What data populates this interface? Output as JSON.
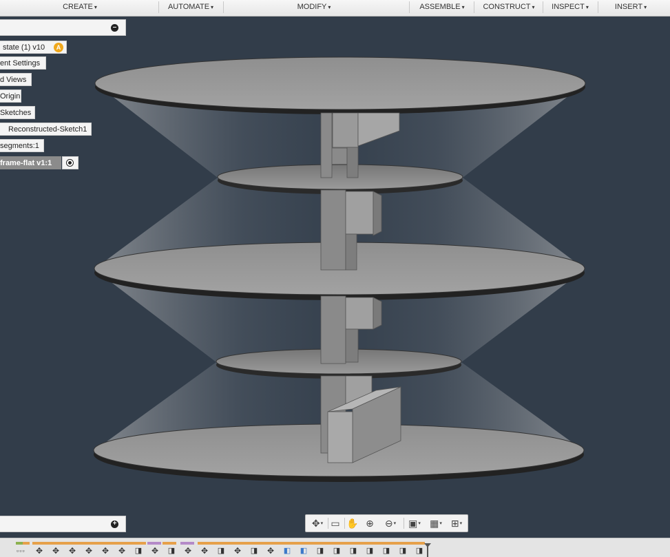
{
  "toolbar": {
    "menus": [
      {
        "label": "CREATE",
        "caret": "▾"
      },
      {
        "label": "AUTOMATE",
        "caret": "▾"
      },
      {
        "label": "MODIFY",
        "caret": "▾"
      },
      {
        "label": "ASSEMBLE",
        "caret": "▾"
      },
      {
        "label": "CONSTRUCT",
        "caret": "▾"
      },
      {
        "label": "INSPECT",
        "caret": "▾"
      },
      {
        "label": "INSERT",
        "caret": "▾"
      }
    ]
  },
  "browser": {
    "collapse_glyph": "–",
    "root_label": "state (1) v10",
    "warning_glyph": "A",
    "nodes": [
      {
        "label": "ent Settings"
      },
      {
        "label": "d Views"
      },
      {
        "label": "Origin"
      },
      {
        "label": "Sketches"
      },
      {
        "label": "Reconstructed-Sketch1"
      },
      {
        "label": "segments:1"
      },
      {
        "label": "frame-flat v1:1"
      }
    ]
  },
  "comments": {
    "expand_glyph": "+"
  },
  "navbar": {
    "icons": [
      {
        "name": "orbit-icon",
        "glyph": "✥"
      },
      {
        "name": "look-at-icon",
        "glyph": "▭"
      },
      {
        "name": "pan-icon",
        "glyph": "✋"
      },
      {
        "name": "zoom-icon",
        "glyph": "⊕"
      },
      {
        "name": "fit-icon",
        "glyph": "⊖"
      },
      {
        "name": "display-settings-icon",
        "glyph": "▣"
      },
      {
        "name": "grid-settings-icon",
        "glyph": "▦"
      },
      {
        "name": "viewports-icon",
        "glyph": "⊞"
      }
    ],
    "dropdown_glyph": "▾"
  },
  "timeline": {
    "dots": "▫▫▫",
    "move_glyph": "✥",
    "body_glyph": "◧",
    "box_glyph": "◨",
    "band_colors": {
      "sketch": "#8bb14f",
      "move": "#e6a04a",
      "feature": "#b48ac8"
    },
    "accent": "#3c79c9"
  },
  "colors": {
    "viewport_bg": "#323d4a",
    "surface": "#9d9d9d",
    "toolbar_bg": "#eeeeee"
  }
}
